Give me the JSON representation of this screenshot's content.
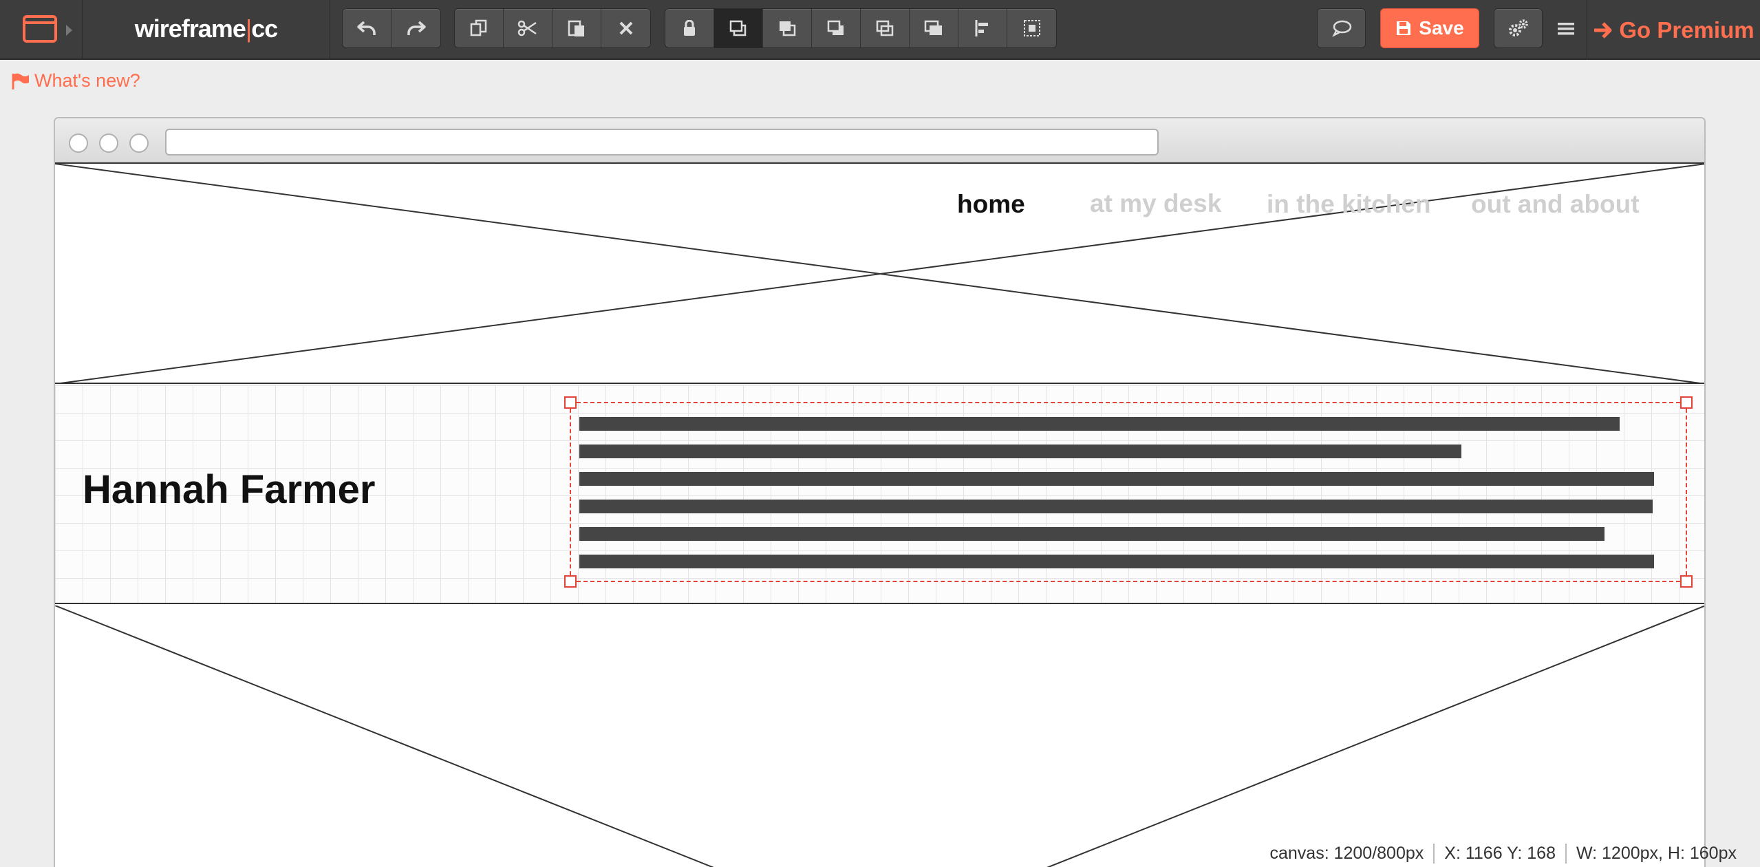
{
  "app": {
    "brand_left": "wireframe",
    "brand_sep": "|",
    "brand_right": "cc"
  },
  "toolbar": {
    "history": [
      {
        "icon": "undo-icon"
      },
      {
        "icon": "redo-icon"
      }
    ],
    "clipboard": [
      {
        "icon": "copy-icon"
      },
      {
        "icon": "cut-icon"
      },
      {
        "icon": "paste-icon"
      },
      {
        "icon": "delete-icon"
      }
    ],
    "arrange": [
      {
        "icon": "lock-icon"
      },
      {
        "icon": "bring-to-front-icon",
        "active": true
      },
      {
        "icon": "bring-forward-icon"
      },
      {
        "icon": "send-backward-icon"
      },
      {
        "icon": "send-to-back-icon"
      },
      {
        "icon": "layer-icon"
      },
      {
        "icon": "align-icon"
      },
      {
        "icon": "select-box-icon"
      }
    ],
    "comment_icon": "comment-icon",
    "save_label": "Save",
    "settings_icon": "gears-icon",
    "menu_icon": "hamburger-icon",
    "premium_label": "Go Premium"
  },
  "whats_new": "What's new?",
  "wireframe": {
    "nav": [
      {
        "label": "home",
        "active": true
      },
      {
        "label": "at my desk",
        "active": false
      },
      {
        "label": "in the kitchen",
        "active": false
      },
      {
        "label": "out and about",
        "active": false
      }
    ],
    "hero_name": "Hannah Farmer"
  },
  "status": {
    "canvas": "canvas: 1200/800px",
    "position": "X: 1166 Y: 168",
    "size": "W: 1200px, H: 160px"
  },
  "colors": {
    "accent": "#ff6f4f",
    "toolbar": "#3d3d3d",
    "selection": "#e2443a"
  }
}
